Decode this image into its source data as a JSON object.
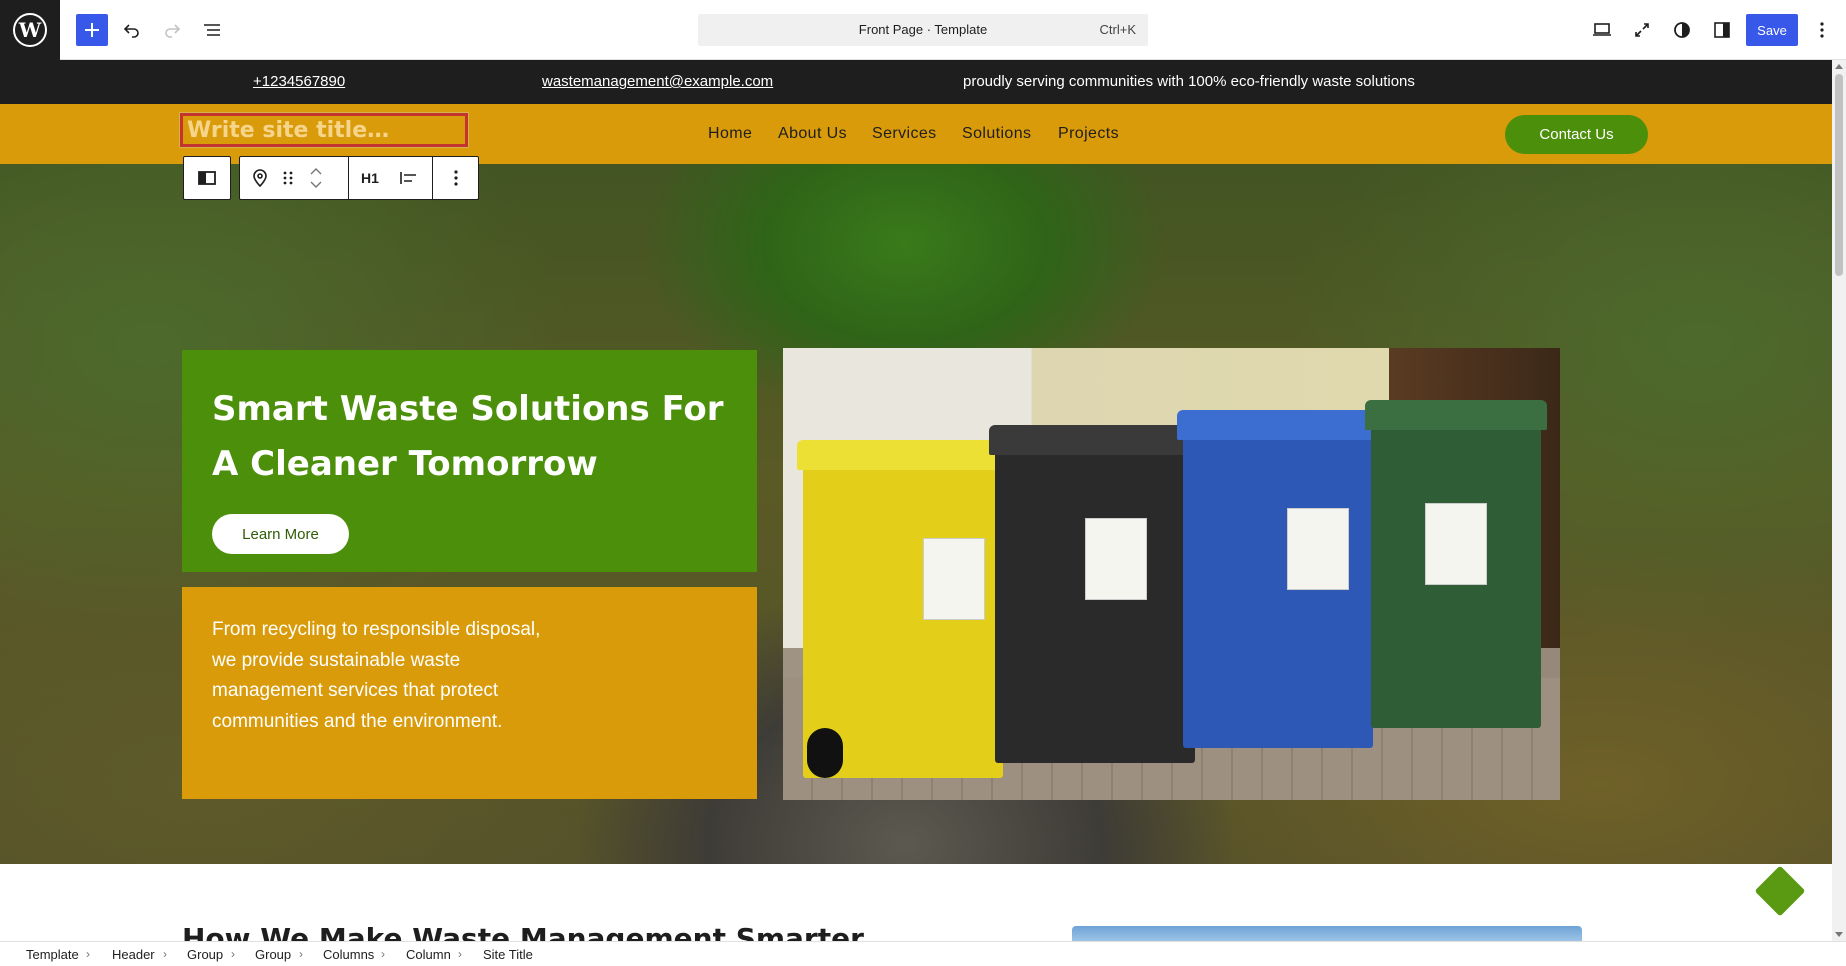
{
  "editor": {
    "document_title": "Front Page · Template",
    "command_shortcut": "Ctrl+K",
    "save_label": "Save",
    "icons": {
      "logo": "wordpress-logo",
      "add": "plus-icon",
      "undo": "undo-icon",
      "redo": "redo-icon",
      "list_view": "list-view-icon",
      "view": "desktop-view-icon",
      "fullscreen": "fullscreen-icon",
      "styles": "styles-icon",
      "settings": "sidebar-settings-icon",
      "options": "kebab-menu-icon"
    },
    "accent_color": "#3858e9"
  },
  "topinfo": {
    "phone": "+1234567890",
    "email": "wastemanagement@example.com",
    "tagline": "proudly serving communities with 100% eco-friendly waste solutions"
  },
  "header": {
    "site_title_placeholder": "Write site title…",
    "nav": [
      "Home",
      "About Us",
      "Services",
      "Solutions",
      "Projects"
    ],
    "contact_label": "Contact Us",
    "header_color": "#d99b0a",
    "button_color": "#4c8f0a"
  },
  "block_toolbar": {
    "heading_level": "H1"
  },
  "hero": {
    "title": "Smart Waste Solutions For A Cleaner Tomorrow",
    "button_label": "Learn More",
    "description": "From recycling to responsible disposal, we provide sustainable waste management services that protect communities and the environment."
  },
  "section": {
    "heading": "How We Make Waste Management Smarter"
  },
  "breadcrumb": [
    "Template",
    "Header",
    "Group",
    "Group",
    "Columns",
    "Column",
    "Site Title"
  ]
}
